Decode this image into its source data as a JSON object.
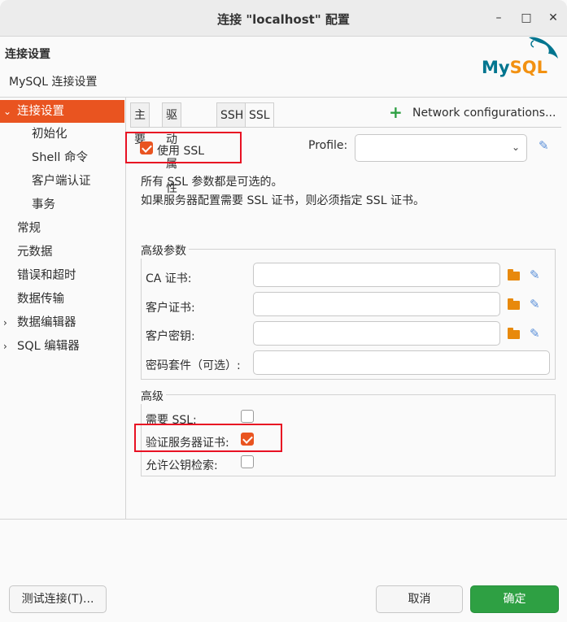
{
  "window": {
    "title": "连接 \"localhost\" 配置",
    "minimize_glyph": "–",
    "maximize_glyph": "□",
    "close_glyph": "✕"
  },
  "header": {
    "title": "连接设置",
    "subtitle": "MySQL 连接设置",
    "logo_text": "MySQL",
    "logo_colors": {
      "my": "#00758f",
      "sql": "#f29111"
    }
  },
  "sidebar": {
    "items": [
      {
        "label": "连接设置",
        "arrow": "⌄",
        "active": true
      },
      {
        "label": "初始化"
      },
      {
        "label": "Shell 命令"
      },
      {
        "label": "客户端认证"
      },
      {
        "label": "事务"
      },
      {
        "label": "常规"
      },
      {
        "label": "元数据"
      },
      {
        "label": "错误和超时"
      },
      {
        "label": "数据传输"
      },
      {
        "label": "数据编辑器",
        "arrow": "›"
      },
      {
        "label": "SQL 编辑器",
        "arrow": "›"
      }
    ]
  },
  "tabs": [
    {
      "label": "主要"
    },
    {
      "label": "驱动属性"
    },
    {
      "label": "SSH"
    },
    {
      "label": "SSL",
      "active": true
    }
  ],
  "network": {
    "plus": "+",
    "label": "Network configurations..."
  },
  "ssl": {
    "use_ssl_label": "使用 SSL",
    "use_ssl_checked": true,
    "profile_label": "Profile:",
    "profile_value": "",
    "chevron": "⌄",
    "info_line1": "所有 SSL 参数都是可选的。",
    "info_line2": "如果服务器配置需要 SSL 证书，则必须指定 SSL 证书。"
  },
  "advanced_params": {
    "legend": "高级参数",
    "ca_label": "CA 证书:",
    "ca_value": "",
    "client_cert_label": "客户证书:",
    "client_cert_value": "",
    "client_key_label": "客户密钥:",
    "client_key_value": "",
    "cipher_label": "密码套件（可选）:",
    "cipher_value": ""
  },
  "advanced": {
    "legend": "高级",
    "require_ssl_label": "需要 SSL:",
    "require_ssl_checked": false,
    "verify_cert_label": "验证服务器证书:",
    "verify_cert_checked": true,
    "allow_pk_label": "允许公钥检索:",
    "allow_pk_checked": false
  },
  "footer": {
    "test_label": "测试连接(T)...",
    "cancel_label": "取消",
    "ok_label": "确定"
  },
  "colors": {
    "accent": "#e95420",
    "highlight": "#e81123",
    "primary_button": "#2ea043",
    "folder": "#e8890c",
    "edit": "#5a8fd8"
  }
}
